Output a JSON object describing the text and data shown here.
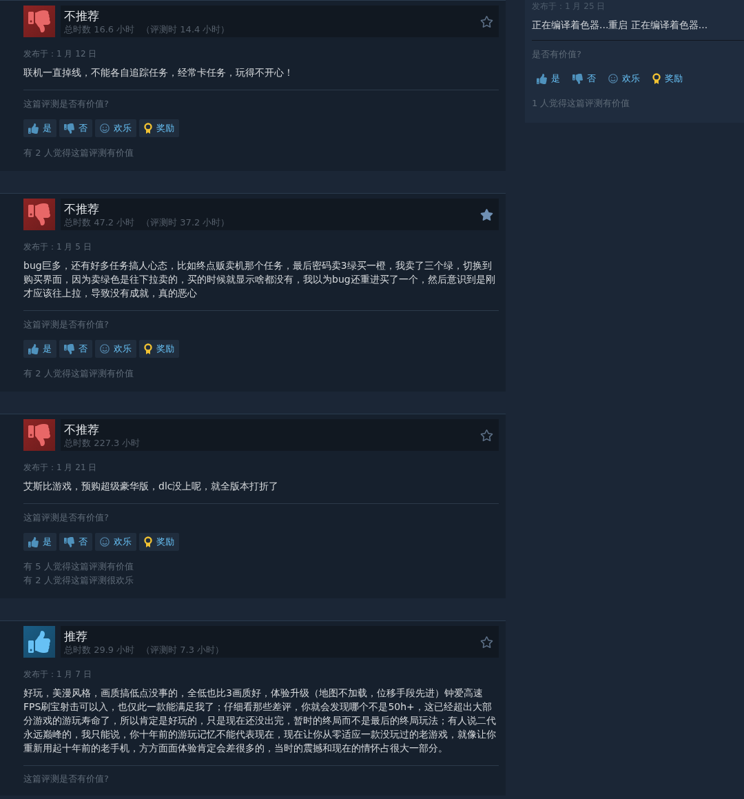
{
  "reviews": [
    {
      "verdict": "不推荐",
      "recommended": false,
      "hours": "总时数 16.6 小时",
      "review_hours": "（评测时 14.4 小时）",
      "favorited": false,
      "posted": "发布于：1 月 12 日",
      "body": "联机一直掉线，不能各自追踪任务，经常卡任务，玩得不开心！",
      "helpful_prompt": "这篇评测是否有价值?",
      "buttons": [
        {
          "kind": "yes",
          "label": "是"
        },
        {
          "kind": "no",
          "label": "否"
        },
        {
          "kind": "funny",
          "label": "欢乐"
        },
        {
          "kind": "award",
          "label": "奖励"
        }
      ],
      "helpful_counts": [
        "有 2 人觉得这篇评测有价值"
      ]
    },
    {
      "verdict": "不推荐",
      "recommended": false,
      "hours": "总时数 47.2 小时",
      "review_hours": "（评测时 37.2 小时）",
      "favorited": true,
      "posted": "发布于：1 月 5 日",
      "body": "bug巨多，还有好多任务搞人心态，比如终点贩卖机那个任务，最后密码卖3绿买一橙，我卖了三个绿，切换到购买界面，因为卖绿色是往下拉卖的，买的时候就显示啥都没有，我以为bug还重进买了一个，然后意识到是刚才应该往上拉，导致没有成就，真的恶心",
      "helpful_prompt": "这篇评测是否有价值?",
      "buttons": [
        {
          "kind": "yes",
          "label": "是"
        },
        {
          "kind": "no",
          "label": "否"
        },
        {
          "kind": "funny",
          "label": "欢乐"
        },
        {
          "kind": "award",
          "label": "奖励"
        }
      ],
      "helpful_counts": [
        "有 2 人觉得这篇评测有价值"
      ]
    },
    {
      "verdict": "不推荐",
      "recommended": false,
      "hours": "总时数 227.3 小时",
      "favorited": false,
      "posted": "发布于：1 月 21 日",
      "body": "艾斯比游戏，预购超级豪华版，dlc没上呢，就全版本打折了",
      "helpful_prompt": "这篇评测是否有价值?",
      "buttons": [
        {
          "kind": "yes",
          "label": "是"
        },
        {
          "kind": "no",
          "label": "否"
        },
        {
          "kind": "funny",
          "label": "欢乐"
        },
        {
          "kind": "award",
          "label": "奖励"
        }
      ],
      "helpful_counts": [
        "有 5 人觉得这篇评测有价值",
        "有 2 人觉得这篇评测很欢乐"
      ]
    },
    {
      "verdict": "推荐",
      "recommended": true,
      "hours": "总时数 29.9 小时",
      "review_hours": "（评测时 7.3 小时）",
      "favorited": false,
      "posted": "发布于：1 月 7 日",
      "body": "好玩，美漫风格，画质搞低点没事的，全低也比3画质好，体验升级（地图不加载，位移手段先进）钟爱高速FPS刷宝射击可以入，也仅此一款能满足我了；仔细看那些差评，你就会发现哪个不是50h+，这已经超出大部分游戏的游玩寿命了，所以肯定是好玩的，只是现在还没出完，暂时的终局而不是最后的终局玩法；有人说二代永远巅峰的，我只能说，你十年前的游玩记忆不能代表现在，现在让你从零适应一款没玩过的老游戏，就像让你重新用起十年前的老手机，方方面面体验肯定会差很多的，当时的震撼和现在的情怀占很大一部分。",
      "helpful_prompt": "这篇评测是否有价值?"
    }
  ],
  "side_review": {
    "posted": "发布于：1 月 25 日",
    "body": "正在编译着色器...重启 正在编译着色器...",
    "helpful_prompt": "是否有价值?",
    "buttons": [
      {
        "kind": "yes",
        "label": "是"
      },
      {
        "kind": "no",
        "label": "否"
      },
      {
        "kind": "funny",
        "label": "欢乐"
      },
      {
        "kind": "award",
        "label": "奖励"
      }
    ],
    "helpful_counts": [
      "1 人觉得这篇评测有价值"
    ]
  }
}
